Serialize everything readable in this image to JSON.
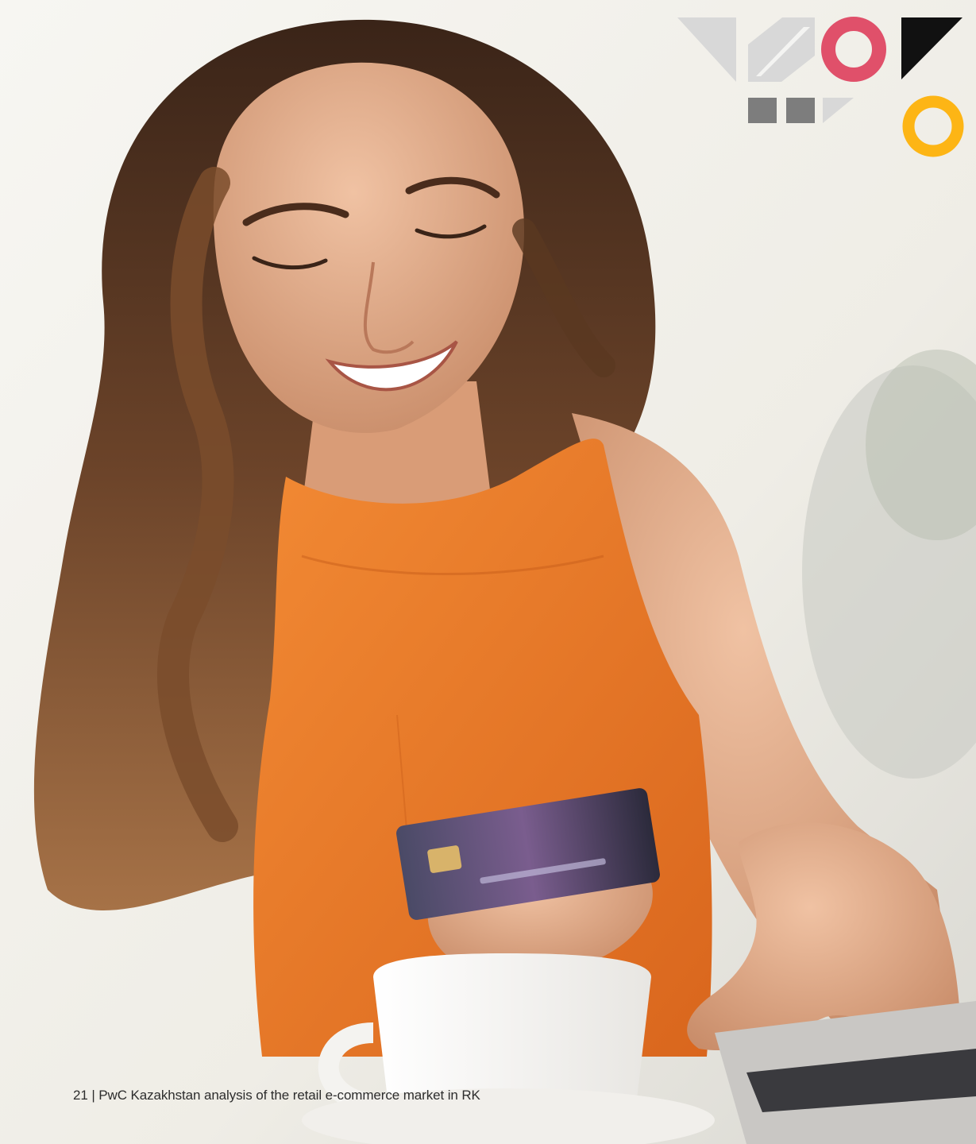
{
  "footer": {
    "page_number": "21",
    "separator": "|",
    "text": "PwC Kazakhstan analysis of the retail e-commerce market in RK"
  },
  "colors": {
    "accent_pink": "#e0506a",
    "accent_yellow": "#fdb515",
    "shape_grey_light": "#d8d8d8",
    "shape_grey_dark": "#7d7d7d",
    "shape_black": "#111111",
    "dress_orange": "#ef7f2a"
  }
}
